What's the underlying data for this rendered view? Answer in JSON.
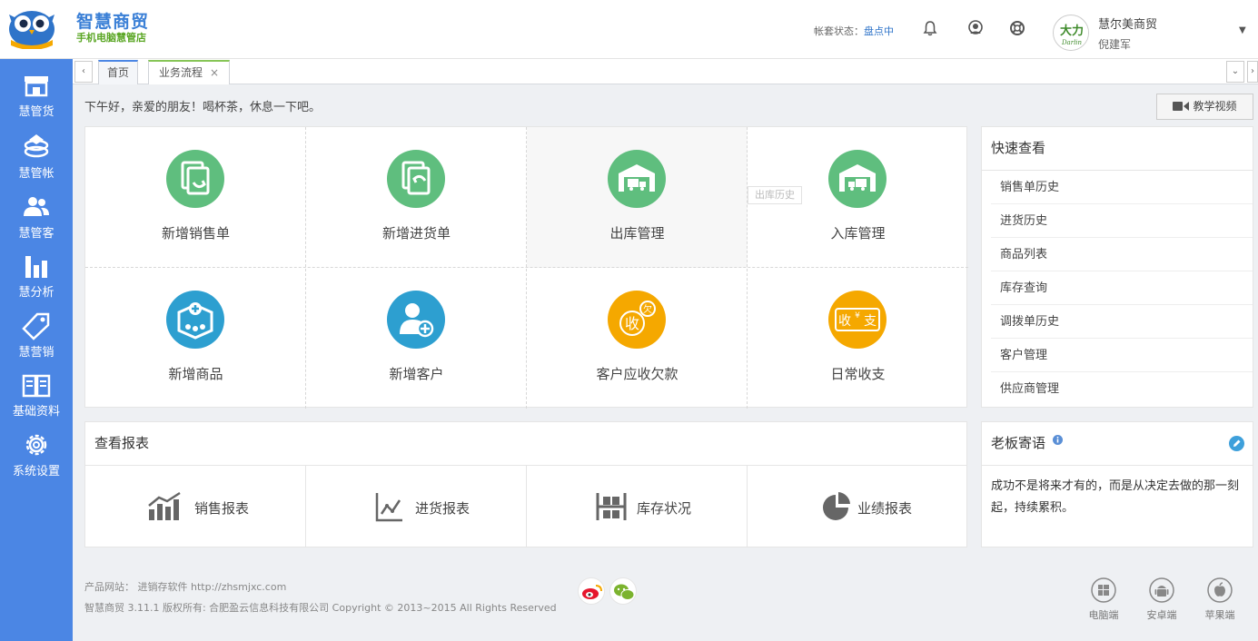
{
  "brand": {
    "title": "智慧商贸",
    "subtitle": "手机电脑慧管店"
  },
  "header": {
    "account_label": "帐套状态：",
    "account_status": "盘点中",
    "company": "慧尔美商贸",
    "user": "倪建军",
    "avatar_text": "大力",
    "avatar_sub": "Darlin"
  },
  "sidebar": {
    "items": [
      {
        "label": "慧管货",
        "icon": "store-icon"
      },
      {
        "label": "慧管帐",
        "icon": "ledger-icon"
      },
      {
        "label": "慧管客",
        "icon": "users-icon"
      },
      {
        "label": "慧分析",
        "icon": "bar-chart-icon"
      },
      {
        "label": "慧营销",
        "icon": "tag-icon"
      },
      {
        "label": "基础资料",
        "icon": "book-icon"
      },
      {
        "label": "系统设置",
        "icon": "gear-icon"
      }
    ]
  },
  "tabs": [
    {
      "label": "首页"
    },
    {
      "label": "业务流程",
      "close": "×"
    }
  ],
  "tab_nav": {
    "prev": "‹",
    "more": "⌄",
    "next": "›"
  },
  "greeting": "下午好，亲爱的朋友！喝杯茶，休息一下吧。",
  "video_button": "教学视频",
  "quick_actions": [
    {
      "label": "新增销售单",
      "color": "#5fbe7e",
      "icon": "sales-doc-icon"
    },
    {
      "label": "新增进货单",
      "color": "#5fbe7e",
      "icon": "purchase-doc-icon"
    },
    {
      "label": "出库管理",
      "color": "#5fbe7e",
      "icon": "outbound-warehouse-icon"
    },
    {
      "label": "入库管理",
      "color": "#5fbe7e",
      "icon": "inbound-warehouse-icon"
    },
    {
      "label": "新增商品",
      "color": "#2d9fd0",
      "icon": "new-product-icon"
    },
    {
      "label": "新增客户",
      "color": "#2d9fd0",
      "icon": "new-customer-icon"
    },
    {
      "label": "客户应收欠款",
      "color": "#f5a800",
      "icon": "receivable-icon",
      "glyph_main": "收",
      "glyph_sub": "欠"
    },
    {
      "label": "日常收支",
      "color": "#f5a800",
      "icon": "income-expense-icon",
      "glyph_left": "收",
      "glyph_mid": "¥",
      "glyph_right": "支"
    }
  ],
  "tooltip": "出库历史",
  "quick_view": {
    "title": "快速查看",
    "items": [
      "销售单历史",
      "进货历史",
      "商品列表",
      "库存查询",
      "调拨单历史",
      "客户管理",
      "供应商管理"
    ]
  },
  "reports": {
    "title": "查看报表",
    "items": [
      {
        "label": "销售报表",
        "icon": "sales-report-icon"
      },
      {
        "label": "进货报表",
        "icon": "purchase-report-icon"
      },
      {
        "label": "库存状况",
        "icon": "stock-status-icon"
      },
      {
        "label": "业绩报表",
        "icon": "pie-report-icon"
      }
    ]
  },
  "boss": {
    "title": "老板寄语",
    "message": "成功不是将来才有的，而是从决定去做的那一刻起，持续累积。"
  },
  "footer": {
    "site": "产品网站： 进销存软件   http://zhsmjxc.com",
    "copyright": "智慧商贸 3.11.1 版权所有: 合肥盈云信息科技有限公司 Copyright © 2013~2015 All Rights Reserved",
    "platforms": [
      {
        "label": "电脑端",
        "icon": "windows-icon"
      },
      {
        "label": "安卓端",
        "icon": "android-icon"
      },
      {
        "label": "苹果端",
        "icon": "apple-icon"
      }
    ]
  },
  "colors": {
    "sidebar": "#4b86e4",
    "green": "#5fbe7e",
    "blue": "#2d9fd0",
    "orange": "#f5a800"
  }
}
